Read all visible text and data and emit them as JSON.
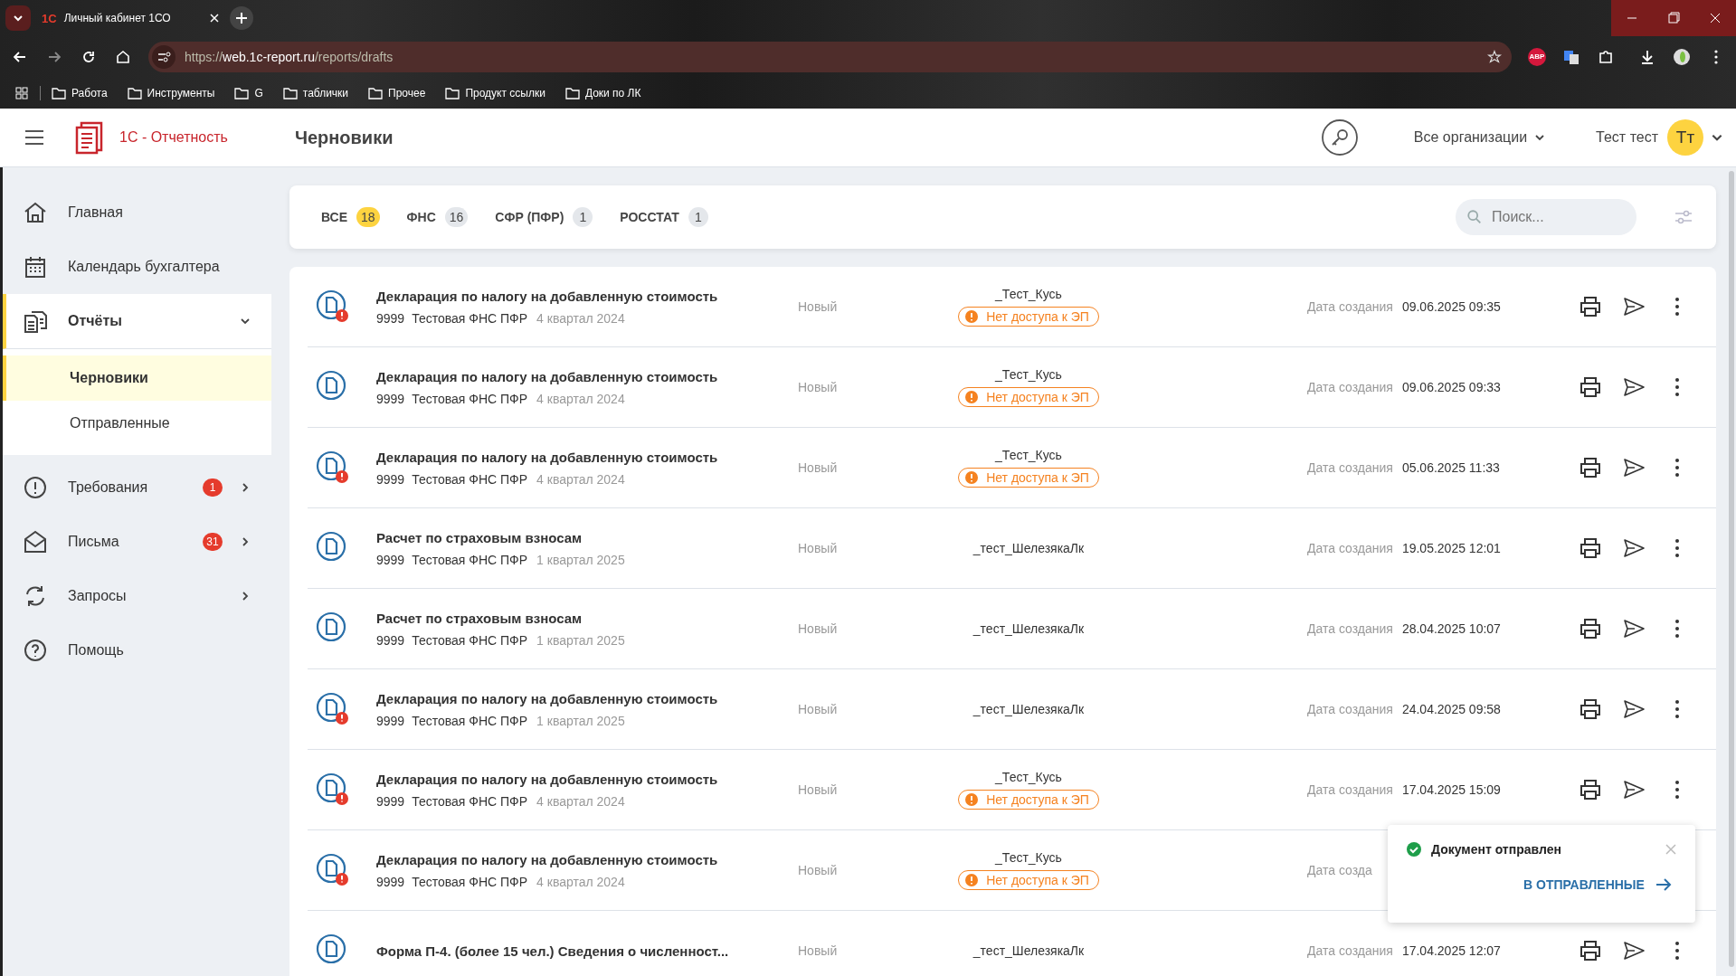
{
  "browser": {
    "tab_title": "Личный кабинет 1СО",
    "tab_logo": "1С",
    "url_host": "web.1c-report.ru",
    "url_scheme": "https://",
    "url_path": "/reports/drafts",
    "extension_label": "ABP",
    "bookmarks": [
      "Работа",
      "Инструменты",
      "G",
      "таблички",
      "Прочее",
      "Продукт ссылки",
      "Доки по ЛК"
    ]
  },
  "header": {
    "app_name": "1С - Отчетность",
    "page_title": "Черновики",
    "organization": "Все организации",
    "user_name": "Тест тест",
    "user_initials": "Тт"
  },
  "sidebar": {
    "items": [
      {
        "kind": "home",
        "label": "Главная",
        "selected": false
      },
      {
        "kind": "calendar",
        "label": "Календарь бухгалтера",
        "selected": false
      },
      {
        "kind": "reports",
        "label": "Отчёты",
        "selected": true,
        "expanded": true,
        "children": [
          {
            "label": "Черновики",
            "selected": true
          },
          {
            "label": "Отправленные",
            "selected": false
          }
        ]
      },
      {
        "kind": "alert",
        "label": "Требования",
        "badge": "1",
        "selected": false,
        "expanded": false
      },
      {
        "kind": "mail",
        "label": "Письма",
        "badge": "31",
        "selected": false,
        "expanded": false
      },
      {
        "kind": "sync",
        "label": "Запросы",
        "selected": false,
        "expanded": false
      },
      {
        "kind": "help",
        "label": "Помощь",
        "selected": false
      }
    ]
  },
  "filters": {
    "tabs": [
      {
        "label": "ВСЕ",
        "count": "18",
        "selected": true
      },
      {
        "label": "ФНС",
        "count": "16",
        "selected": false
      },
      {
        "label": "СФР (ПФР)",
        "count": "1",
        "selected": false
      },
      {
        "label": "РОССТАТ",
        "count": "1",
        "selected": false
      }
    ],
    "search": {
      "placeholder": "Поиск..."
    }
  },
  "rows": [
    {
      "title": "Декларация по налогу на добавленную стоимость",
      "code": "9999",
      "org": "Тестовая ФНС ПФР",
      "period": "4 квартал 2024",
      "warning": true,
      "status": "Новый",
      "owner": "_Тест_Кусь",
      "ep_badge": "Нет доступа к ЭП",
      "date_label": "Дата создания",
      "date": "09.06.2025 09:35"
    },
    {
      "title": "Декларация по налогу на добавленную стоимость",
      "code": "9999",
      "org": "Тестовая ФНС ПФР",
      "period": "4 квартал 2024",
      "warning": false,
      "status": "Новый",
      "owner": "_Тест_Кусь",
      "ep_badge": "Нет доступа к ЭП",
      "date_label": "Дата создания",
      "date": "09.06.2025 09:33"
    },
    {
      "title": "Декларация по налогу на добавленную стоимость",
      "code": "9999",
      "org": "Тестовая ФНС ПФР",
      "period": "4 квартал 2024",
      "warning": true,
      "status": "Новый",
      "owner": "_Тест_Кусь",
      "ep_badge": "Нет доступа к ЭП",
      "date_label": "Дата создания",
      "date": "05.06.2025 11:33"
    },
    {
      "title": "Расчет по страховым взносам",
      "code": "9999",
      "org": "Тестовая ФНС ПФР",
      "period": "1 квартал 2025",
      "warning": false,
      "status": "Новый",
      "owner": "_тест_ШелезякаЛк",
      "date_label": "Дата создания",
      "date": "19.05.2025 12:01"
    },
    {
      "title": "Расчет по страховым взносам",
      "code": "9999",
      "org": "Тестовая ФНС ПФР",
      "period": "1 квартал 2025",
      "warning": false,
      "status": "Новый",
      "owner": "_тест_ШелезякаЛк",
      "date_label": "Дата создания",
      "date": "28.04.2025 10:07"
    },
    {
      "title": "Декларация по налогу на добавленную стоимость",
      "code": "9999",
      "org": "Тестовая ФНС ПФР",
      "period": "1 квартал 2025",
      "warning": true,
      "status": "Новый",
      "owner": "_тест_ШелезякаЛк",
      "date_label": "Дата создания",
      "date": "24.04.2025 09:58"
    },
    {
      "title": "Декларация по налогу на добавленную стоимость",
      "code": "9999",
      "org": "Тестовая ФНС ПФР",
      "period": "4 квартал 2024",
      "warning": true,
      "status": "Новый",
      "owner": "_Тест_Кусь",
      "ep_badge": "Нет доступа к ЭП",
      "date_label": "Дата создания",
      "date": "17.04.2025 15:09"
    },
    {
      "title": "Декларация по налогу на добавленную стоимость",
      "code": "9999",
      "org": "Тестовая ФНС ПФР",
      "period": "4 квартал 2024",
      "warning": true,
      "status": "Новый",
      "owner": "_Тест_Кусь",
      "ep_badge": "Нет доступа к ЭП",
      "date_label": "Дата созда",
      "actions": false
    },
    {
      "title": "Форма П-4. (более 15 чел.) Сведения о численност...",
      "warning": false,
      "status": "Новый",
      "owner": "_тест_ШелезякаЛк",
      "date_label": "Дата создания",
      "date": "17.04.2025 12:07"
    }
  ],
  "toast": {
    "message": "Документ отправлен",
    "action": "В ОТПРАВЛЕННЫЕ"
  }
}
